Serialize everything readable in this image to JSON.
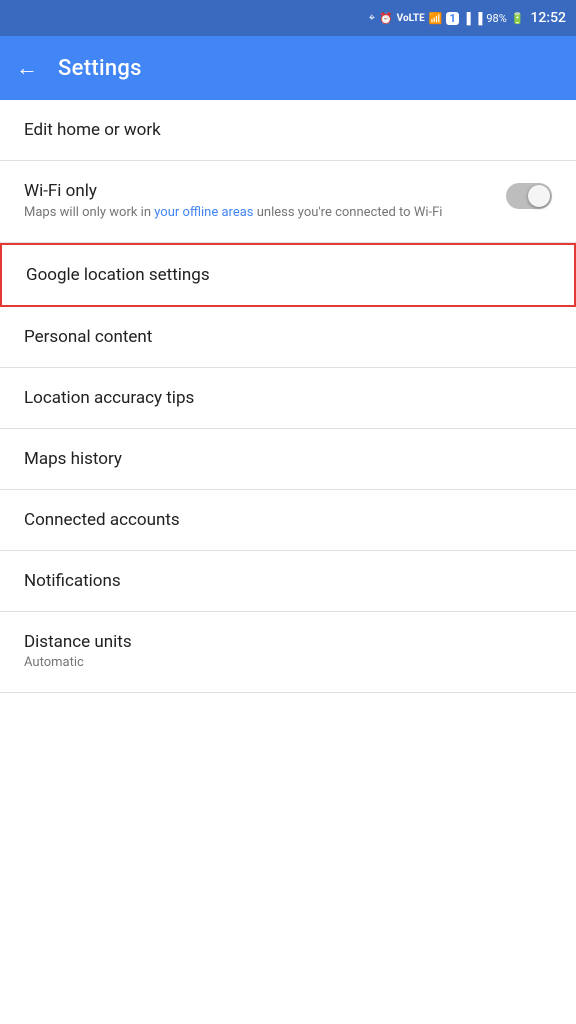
{
  "status_bar": {
    "battery": "98%",
    "time": "12:52",
    "icons": [
      "location",
      "alarm",
      "volte",
      "wifi",
      "notification",
      "signal1",
      "signal2"
    ]
  },
  "app_bar": {
    "title": "Settings",
    "back_label": "←"
  },
  "settings_items": [
    {
      "id": "edit-home-work",
      "title": "Edit home or work",
      "subtitle": null,
      "has_toggle": false,
      "highlighted": false
    },
    {
      "id": "wifi-only",
      "title": "Wi-Fi only",
      "subtitle": "Maps will only work in your offline areas unless you're connected to Wi-Fi",
      "subtitle_link_text": "your offline areas",
      "has_toggle": true,
      "toggle_on": false,
      "highlighted": false
    },
    {
      "id": "google-location-settings",
      "title": "Google location settings",
      "subtitle": null,
      "has_toggle": false,
      "highlighted": true
    },
    {
      "id": "personal-content",
      "title": "Personal content",
      "subtitle": null,
      "has_toggle": false,
      "highlighted": false
    },
    {
      "id": "location-accuracy-tips",
      "title": "Location accuracy tips",
      "subtitle": null,
      "has_toggle": false,
      "highlighted": false
    },
    {
      "id": "maps-history",
      "title": "Maps history",
      "subtitle": null,
      "has_toggle": false,
      "highlighted": false
    },
    {
      "id": "connected-accounts",
      "title": "Connected accounts",
      "subtitle": null,
      "has_toggle": false,
      "highlighted": false
    },
    {
      "id": "notifications",
      "title": "Notifications",
      "subtitle": null,
      "has_toggle": false,
      "highlighted": false
    },
    {
      "id": "distance-units",
      "title": "Distance units",
      "subtitle": "Automatic",
      "has_toggle": false,
      "highlighted": false
    }
  ],
  "colors": {
    "app_bar": "#4285f4",
    "status_bar": "#3a6abf",
    "highlight_border": "#e53935",
    "link": "#4285f4"
  }
}
